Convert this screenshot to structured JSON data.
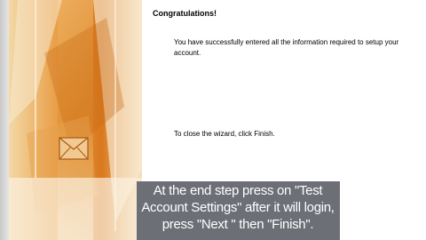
{
  "wizard": {
    "heading": "Congratulations!",
    "message": "You have successfully entered all the information required to setup your account.",
    "close_instruction": "To close the wizard, click Finish."
  },
  "caption": {
    "line1": "At the end step press on \"Test",
    "line2": "Account Settings\" after it will login,",
    "line3": "press \"Next \" then \"Finish\"."
  },
  "colors": {
    "banner_orange": "#e8962a",
    "caption_bg": "#6d6f76"
  }
}
